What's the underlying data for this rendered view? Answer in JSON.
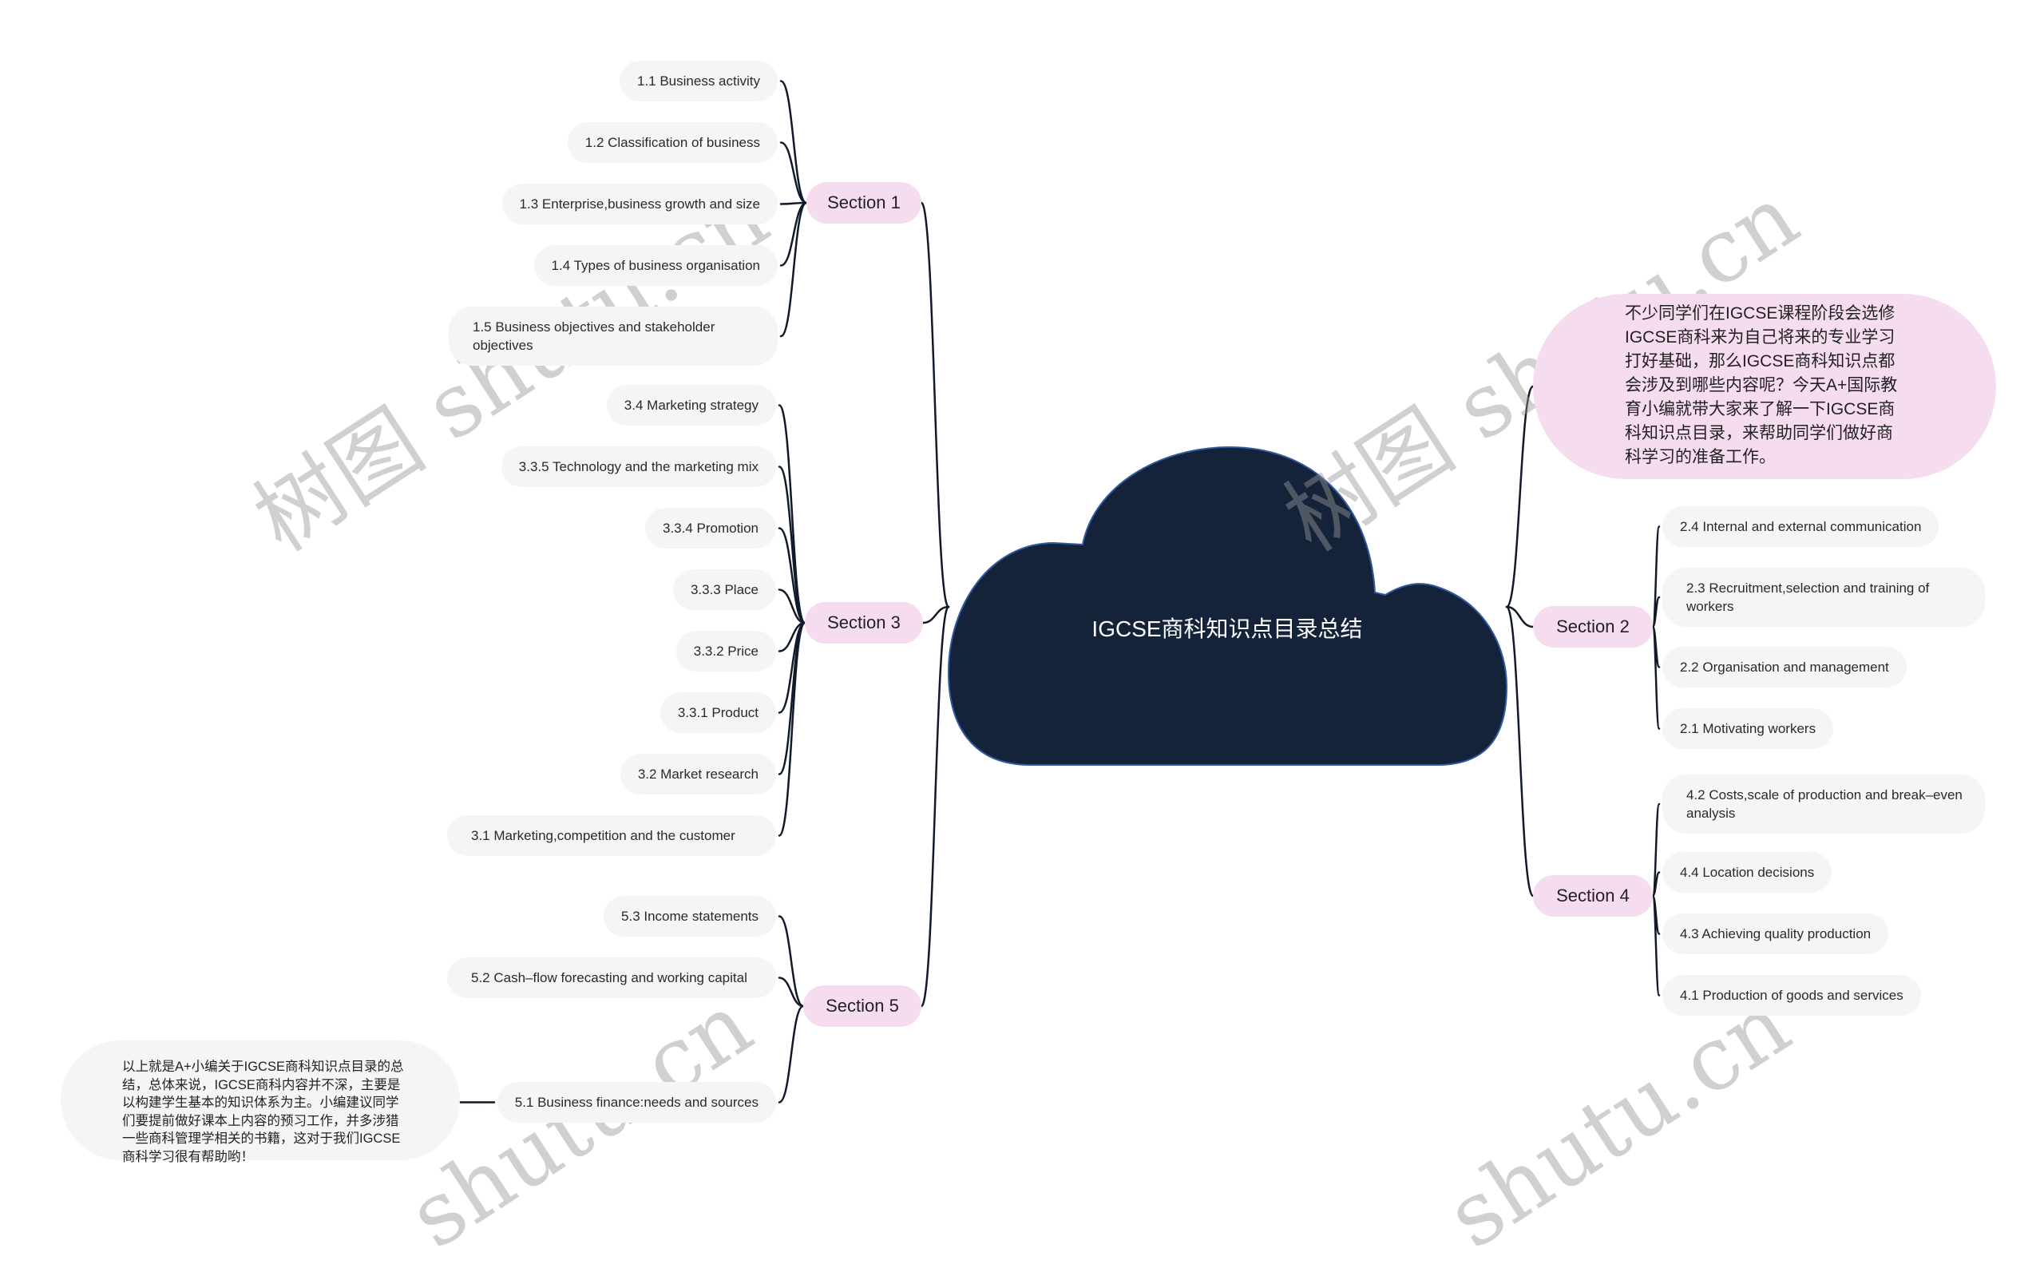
{
  "central": {
    "title": "IGCSE商科知识点目录总结",
    "color": "#15233a"
  },
  "colors": {
    "section_fill": "#f6dcef",
    "leaf_fill": "#f5f5f5",
    "line": "#111a2a"
  },
  "intro_bubble": {
    "text": "不少同学们在IGCSE课程阶段会选修IGCSE商科来为自己将来的专业学习打好基础，那么IGCSE商科知识点都会涉及到哪些内容呢？今天A+国际教育小编就带大家来了解一下IGCSE商科知识点目录，来帮助同学们做好商科学习的准备工作。"
  },
  "sections": {
    "s1": {
      "label": "Section 1",
      "items": [
        "1.1 Business activity",
        "1.2 Classification of business",
        "1.3 Enterprise,business growth and size",
        "1.4 Types of business organisation",
        "1.5 Business objectives and stakeholder objectives"
      ]
    },
    "s2": {
      "label": "Section 2",
      "items": [
        "2.4 Internal and external communication",
        "2.3 Recruitment,selection and training of workers",
        "2.2 Organisation and management",
        "2.1 Motivating workers"
      ]
    },
    "s3": {
      "label": "Section 3",
      "items": [
        "3.4 Marketing strategy",
        "3.3.5 Technology and the marketing mix",
        "3.3.4 Promotion",
        "3.3.3 Place",
        "3.3.2 Price",
        "3.3.1 Product",
        "3.2 Market research",
        "3.1 Marketing,competition and the customer"
      ]
    },
    "s4": {
      "label": "Section 4",
      "items": [
        "4.2 Costs,scale of production and break–even analysis",
        "4.4 Location decisions",
        "4.3 Achieving quality production",
        "4.1 Production of goods and services"
      ]
    },
    "s5": {
      "label": "Section 5",
      "items": [
        "5.3 Income statements",
        "5.2 Cash–flow forecasting and working capital",
        "5.1 Business finance:needs and sources"
      ]
    }
  },
  "summary_note": {
    "text": "以上就是A+小编关于IGCSE商科知识点目录的总结，总体来说，IGCSE商科内容并不深，主要是以构建学生基本的知识体系为主。小编建议同学们要提前做好课本上内容的预习工作，并多涉猎一些商科管理学相关的书籍，这对于我们IGCSE商科学习很有帮助哟！"
  },
  "watermarks": [
    "树图 shutu.cn",
    "树图 shutu.cn",
    "shutu.cn",
    "shutu.cn"
  ]
}
